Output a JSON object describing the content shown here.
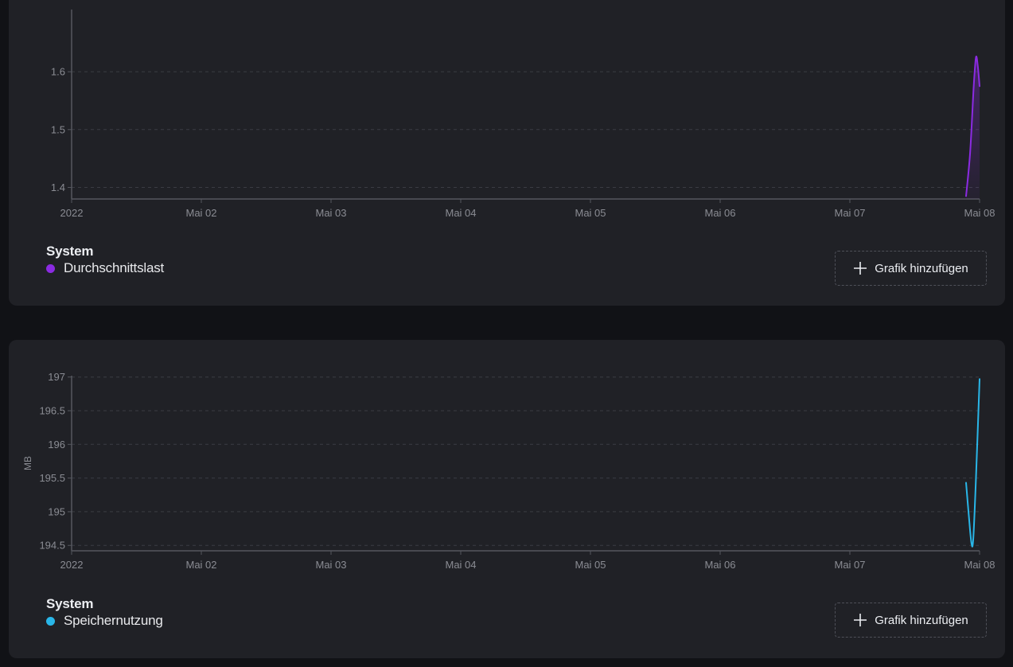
{
  "colors": {
    "background": "#111216",
    "card": "#202126",
    "axis": "#55575e",
    "grid": "#3a3c43",
    "tick_text": "#8a8c93",
    "purple_series": "#8b2be2",
    "cyan_series": "#29b6e8"
  },
  "charts": [
    {
      "legend": {
        "group": "System",
        "series_label": "Durchschnittslast"
      },
      "add_button_label": "Grafik hinzufügen",
      "add_icon": "plus-icon"
    },
    {
      "legend": {
        "group": "System",
        "series_label": "Speichernutzung"
      },
      "add_button_label": "Grafik hinzufügen",
      "add_icon": "plus-icon"
    }
  ],
  "chart_data": [
    {
      "type": "area",
      "x_tick_labels": [
        "2022",
        "Mai 02",
        "Mai 03",
        "Mai 04",
        "Mai 05",
        "Mai 06",
        "Mai 07",
        "Mai 08"
      ],
      "xlim": [
        "2022-05-01",
        "2022-05-08"
      ],
      "y_ticks": [
        "1.4",
        "1.5",
        "1.6"
      ],
      "ylim": [
        1.38,
        1.68
      ],
      "ylabel": "",
      "grid": true,
      "series": [
        {
          "name": "Durchschnittslast",
          "color": "#8b2be2",
          "x": [
            "2022-05-07 21:30",
            "2022-05-07 22:15",
            "2022-05-07 22:55",
            "2022-05-07 23:20",
            "2022-05-07 23:40",
            "2022-05-08 00:00"
          ],
          "y": [
            1.385,
            1.46,
            1.575,
            1.625,
            1.61,
            1.575
          ]
        }
      ]
    },
    {
      "type": "line",
      "x_tick_labels": [
        "2022",
        "Mai 02",
        "Mai 03",
        "Mai 04",
        "Mai 05",
        "Mai 06",
        "Mai 07",
        "Mai 08"
      ],
      "xlim": [
        "2022-05-01",
        "2022-05-08"
      ],
      "y_ticks": [
        "194.5",
        "195",
        "195.5",
        "196",
        "196.5",
        "197"
      ],
      "ylim": [
        194.42,
        197.02
      ],
      "ylabel": "MB",
      "grid": true,
      "series": [
        {
          "name": "Speichernutzung",
          "color": "#29b6e8",
          "x": [
            "2022-05-07 21:30",
            "2022-05-07 22:00",
            "2022-05-07 22:30",
            "2022-05-07 22:50",
            "2022-05-07 23:20",
            "2022-05-08 00:00"
          ],
          "y": [
            195.43,
            194.95,
            194.53,
            194.6,
            195.5,
            196.97
          ]
        }
      ]
    }
  ]
}
